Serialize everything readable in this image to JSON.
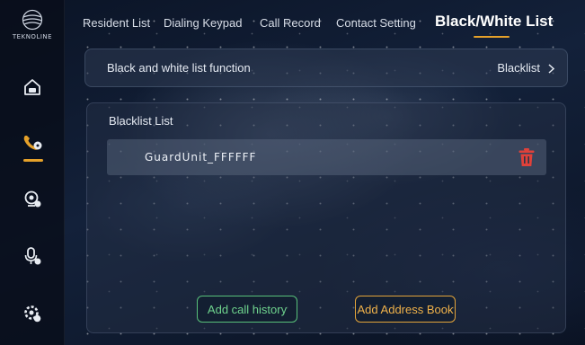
{
  "sidebar": {
    "logo_text": "TEKNOLINE",
    "items": [
      {
        "icon": "home-lock-icon"
      },
      {
        "icon": "phone-call-icon",
        "active": true
      },
      {
        "icon": "camera-user-icon"
      },
      {
        "icon": "mic-user-icon"
      },
      {
        "icon": "settings-gear-icon"
      }
    ],
    "accent": "#e5a12a"
  },
  "tabs": [
    {
      "label": "Resident List"
    },
    {
      "label": "Dialing Keypad"
    },
    {
      "label": "Call Record"
    },
    {
      "label": "Contact Setting"
    },
    {
      "label": "Black/White List",
      "active": true
    }
  ],
  "function_row": {
    "label": "Black and white list function",
    "value": "Blacklist"
  },
  "list_panel": {
    "title": "Blacklist List",
    "entries": [
      {
        "name": "GuardUnit_FFFFFF"
      }
    ]
  },
  "buttons": {
    "add_call_history": "Add call history",
    "add_address_book": "Add Address Book"
  },
  "colors": {
    "accent": "#e5a12a",
    "delete": "#e0413a",
    "green_button": "#58c07a",
    "orange_button": "#e3a43a"
  }
}
